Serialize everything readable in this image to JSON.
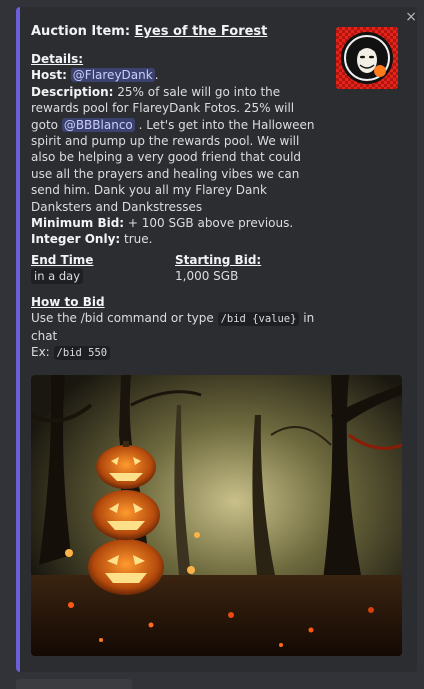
{
  "embed": {
    "title_prefix": "Auction Item: ",
    "title_link": "Eyes of the Forest",
    "close_glyph": "×",
    "accent_color": "#6c5fd8",
    "thumbnail_icon": "anonymous-mask-avatar"
  },
  "details": {
    "heading": "Details:",
    "host_label": "Host:",
    "host_mention": "@FlareyDank",
    "host_after": ".",
    "description_label": "Description:",
    "description_part1": " 25% of sale will go into the rewards pool for FlareyDank Fotos. 25% will goto ",
    "description_mention": "@BBBlanco",
    "description_part2": " . Let's get into the Halloween spirit and pump up the rewards pool. We will also be helping a very good friend that could use all the prayers and healing vibes we can send him. Dank you all my Flarey Dank Danksters and Dankstresses",
    "min_bid_label": "Minimum Bid:",
    "min_bid_value": " + 100 SGB above previous.",
    "integer_label": "Integer Only:",
    "integer_value": " true."
  },
  "fields": {
    "end_time_name": "End Time",
    "end_time_value": "in a day",
    "starting_bid_name": "Starting Bid:",
    "starting_bid_value": "1,000 SGB"
  },
  "howto": {
    "heading": "How to Bid",
    "line_part1": "Use the /bid command or type ",
    "line_code": "/bid {value}",
    "line_part2": " in chat",
    "example_prefix": "Ex: ",
    "example_code": "/bid 550"
  },
  "image": {
    "subject": "halloween-pumpkins-forest-image"
  }
}
